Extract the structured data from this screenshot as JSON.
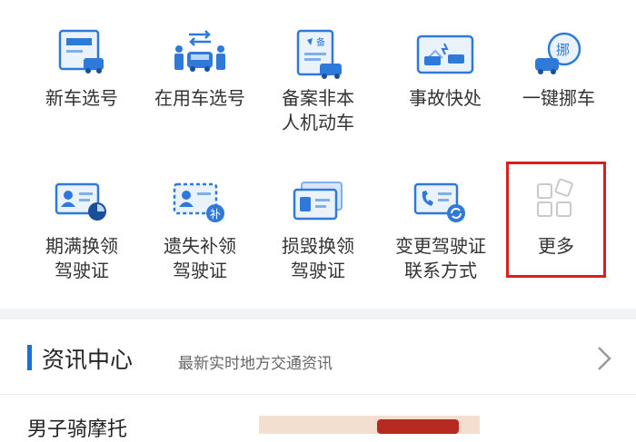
{
  "services_row1": [
    {
      "label": "新车选号",
      "icon": "new-car-plate-icon"
    },
    {
      "label": "在用车选号",
      "icon": "car-swap-icon"
    },
    {
      "label": "备案非本\n人机动车",
      "icon": "register-document-icon"
    },
    {
      "label": "事故快处",
      "icon": "accident-photo-icon"
    },
    {
      "label": "一键挪车",
      "icon": "move-car-icon"
    }
  ],
  "services_row2": [
    {
      "label": "期满换领\n驾驶证",
      "icon": "license-renew-icon"
    },
    {
      "label": "遗失补领\n驾驶证",
      "icon": "license-replace-icon"
    },
    {
      "label": "损毁换领\n驾驶证",
      "icon": "license-damaged-icon"
    },
    {
      "label": "变更驾驶证\n联系方式",
      "icon": "license-contact-change-icon"
    },
    {
      "label": "更多",
      "icon": "more-grid-icon"
    }
  ],
  "icon_texts": {
    "register_badge": "备",
    "move_badge": "挪",
    "replace_badge": "补"
  },
  "news": {
    "title": "资讯中心",
    "subtitle": "最新实时地方交通资讯"
  },
  "article": {
    "title_partial": "男子骑摩托"
  },
  "colors": {
    "accent": "#1b6fd6",
    "highlight": "#d81e1e",
    "icon_light": "#5b9be3"
  }
}
